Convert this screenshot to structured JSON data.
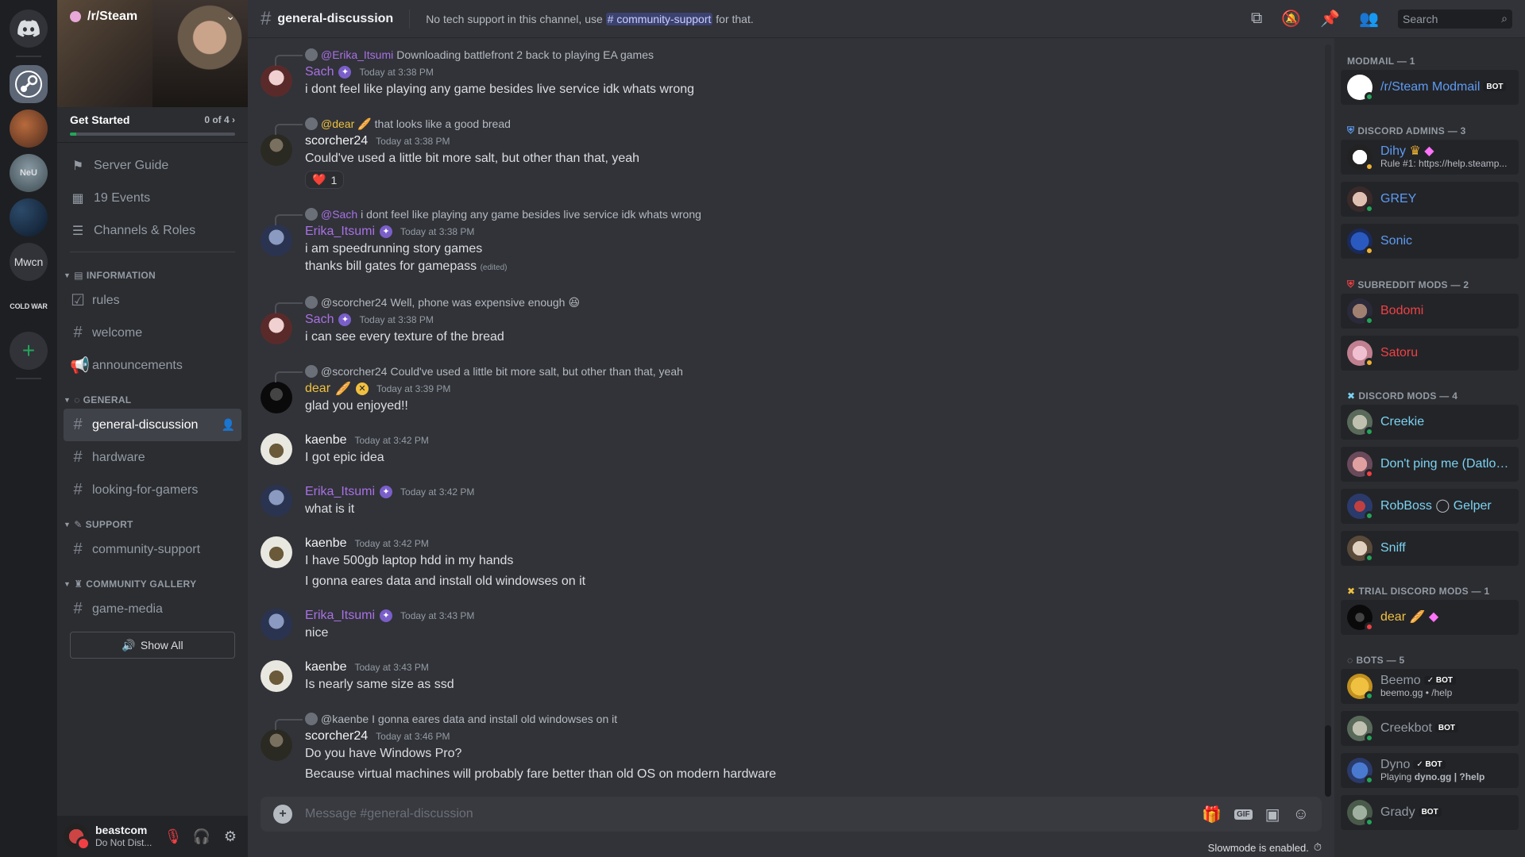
{
  "rail": {
    "servers": [
      "Mwcn",
      "NeU",
      "COLD WAR"
    ],
    "add_icon": "+"
  },
  "guild": {
    "name": "/r/Steam",
    "get_started": "Get Started",
    "progress_label": "0 of 4",
    "progress_fraction": 0.04
  },
  "nav": {
    "server_guide": "Server Guide",
    "events": "19 Events",
    "channels_roles": "Channels & Roles"
  },
  "categories": {
    "information": "INFORMATION",
    "general": "GENERAL",
    "support": "SUPPORT",
    "gallery": "COMMUNITY GALLERY"
  },
  "channels": {
    "rules": "rules",
    "welcome": "welcome",
    "announcements": "announcements",
    "general_discussion": "general-discussion",
    "hardware": "hardware",
    "looking_for_gamers": "looking-for-gamers",
    "community_support": "community-support",
    "game_media": "game-media",
    "show_all": "Show All"
  },
  "user": {
    "name": "beastcom",
    "status": "Do Not Dist..."
  },
  "topbar": {
    "channel": "general-discussion",
    "topic_pre": "No tech support in this channel, use",
    "topic_mention": "# community-support",
    "topic_post": "for that.",
    "search_placeholder": "Search"
  },
  "messages": [
    {
      "reply_name": "@Erika_Itsumi",
      "reply_text": "Downloading battlefront 2 back to playing EA games",
      "author": "Sach",
      "ts": "Today at 3:38 PM",
      "lines": [
        "i dont feel like playing any game besides live service idk whats wrong"
      ]
    },
    {
      "reply_name": "@dear",
      "reply_text": "that looks like a good bread",
      "author": "scorcher24",
      "ts": "Today at 3:38 PM",
      "lines": [
        "Could've used a little bit more salt, but other than that, yeah"
      ],
      "reaction": "1"
    },
    {
      "reply_name": "@Sach",
      "reply_text": "i dont feel like playing any game besides live service idk whats wrong",
      "author": "Erika_Itsumi",
      "ts": "Today at 3:38 PM",
      "lines": [
        "i am speedrunning story games",
        "thanks bill gates for gamepass"
      ],
      "edited": "(edited)"
    },
    {
      "reply_name": "@scorcher24",
      "reply_text": "Well, phone was expensive enough",
      "author": "Sach",
      "ts": "Today at 3:38 PM",
      "lines": [
        "i can see every texture of the bread"
      ]
    },
    {
      "reply_name": "@scorcher24",
      "reply_text": "Could've used a little bit more salt, but other than that, yeah",
      "author": "dear",
      "ts": "Today at 3:39 PM",
      "lines": [
        "glad you enjoyed!!"
      ]
    },
    {
      "author": "kaenbe",
      "ts": "Today at 3:42 PM",
      "lines": [
        "I got epic idea"
      ]
    },
    {
      "author": "Erika_Itsumi",
      "ts": "Today at 3:42 PM",
      "lines": [
        "what is it"
      ]
    },
    {
      "author": "kaenbe",
      "ts": "Today at 3:42 PM",
      "lines": [
        "I have 500gb laptop hdd in my hands",
        "I gonna eares data and install old windowses on it"
      ]
    },
    {
      "author": "Erika_Itsumi",
      "ts": "Today at 3:43 PM",
      "lines": [
        "nice"
      ]
    },
    {
      "author": "kaenbe",
      "ts": "Today at 3:43 PM",
      "lines": [
        "Is nearly same size as ssd"
      ]
    },
    {
      "reply_name": "@kaenbe",
      "reply_text": "I gonna eares data and install old windowses on it",
      "author": "scorcher24",
      "ts": "Today at 3:46 PM",
      "lines": [
        "Do you have Windows Pro?",
        "Because virtual machines will probably fare better than old OS on modern hardware"
      ]
    }
  ],
  "composer": {
    "placeholder": "Message #general-discussion",
    "gif": "GIF",
    "slowmode": "Slowmode is enabled."
  },
  "members": {
    "modmail": "MODMAIL — 1",
    "modmail_bot": "/r/Steam Modmail",
    "admins": "DISCORD ADMINS — 3",
    "dihy": "Dihy",
    "dihy_sub": "Rule #1: https://help.steamp...",
    "grey": "GREY",
    "sonic": "Sonic",
    "submods": "SUBREDDIT MODS — 2",
    "bodomi": "Bodomi",
    "satoru": "Satoru",
    "dmods": "DISCORD MODS — 4",
    "creekie": "Creekie",
    "dontping": "Don't ping me (Datlos...",
    "robboss": "RobBoss",
    "robboss_extra": "Gelper",
    "sniff": "Sniff",
    "trial": "TRIAL DISCORD MODS — 1",
    "dear": "dear",
    "bots": "BOTS — 5",
    "beemo": "Beemo",
    "beemo_sub": "beemo.gg • /help",
    "creekbot": "Creekbot",
    "dyno": "Dyno",
    "dyno_sub_pre": "Playing",
    "dyno_sub": "dyno.gg | ?help",
    "grady": "Grady",
    "bot_tag": "BOT",
    "bot_tag_check": "✓ BOT"
  }
}
